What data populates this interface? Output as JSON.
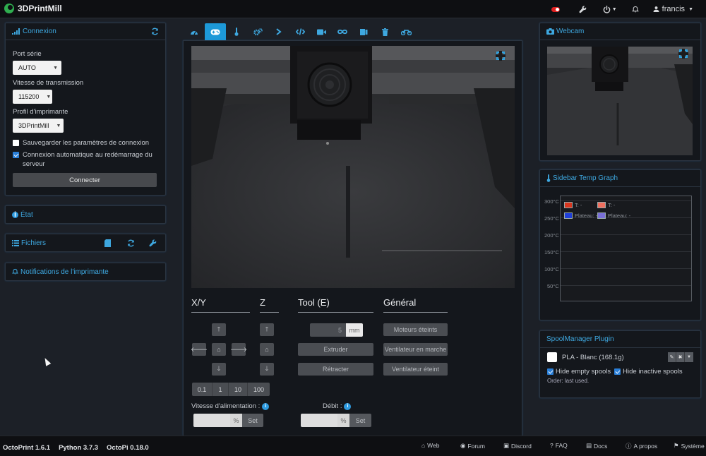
{
  "navbar": {
    "brand": "3DPrintMill",
    "user": "francis"
  },
  "connection": {
    "title": "Connexion",
    "port_label": "Port série",
    "port_value": "AUTO",
    "baud_label": "Vitesse de transmission",
    "baud_value": "115200",
    "profile_label": "Profil d'imprimante",
    "profile_value": "3DPrintMill",
    "save_label": "Sauvegarder les paramètres de connexion",
    "save_checked": false,
    "auto_label": "Connexion automatique au redémarrage du serveur",
    "auto_checked": true,
    "connect_button": "Connecter"
  },
  "state_panel": {
    "title": "État"
  },
  "files_panel": {
    "title": "Fichiers"
  },
  "notifications_panel": {
    "title": "Notifications de l'imprimante"
  },
  "tabs": [
    {
      "name": "temperature-tab",
      "icon": "gauge"
    },
    {
      "name": "control-tab",
      "icon": "gamepad",
      "active": true
    },
    {
      "name": "thermometer-tab",
      "icon": "thermometer"
    },
    {
      "name": "gcode-viewer-tab",
      "icon": "gears"
    },
    {
      "name": "terminal-tab",
      "icon": "chevron-right"
    },
    {
      "name": "code-tab",
      "icon": "code"
    },
    {
      "name": "timelapse-tab",
      "icon": "video-camera"
    },
    {
      "name": "loop-tab",
      "icon": "infinity"
    },
    {
      "name": "spool-tab",
      "icon": "spool"
    },
    {
      "name": "delete-tab",
      "icon": "trash"
    },
    {
      "name": "motorcycle-tab",
      "icon": "motorcycle"
    }
  ],
  "controls": {
    "xy_title": "X/Y",
    "z_title": "Z",
    "tool_title": "Tool (E)",
    "general_title": "Général",
    "step_sizes": [
      "0.1",
      "1",
      "10",
      "100"
    ],
    "extrude_amount": "5",
    "extrude_unit": "mm",
    "extrude_button": "Extruder",
    "retract_button": "Rétracter",
    "motors_off": "Moteurs éteints",
    "fan_on": "Ventilateur en marche",
    "fan_off": "Ventilateur éteint",
    "feed_label": "Vitesse d'alimentation :",
    "flow_label": "Débit :",
    "percent": "%",
    "set_button": "Set"
  },
  "webcam_panel": {
    "title": "Webcam"
  },
  "temp_graph": {
    "title": "Sidebar Temp Graph",
    "y_labels": [
      "300°C",
      "250°C",
      "200°C",
      "150°C",
      "100°C",
      "50°C"
    ],
    "legend": [
      {
        "label": "T: -",
        "color": "#d9361f"
      },
      {
        "label": "T: -",
        "color": "#f07060"
      },
      {
        "label": "Plateau: -",
        "color": "#1f3fd9"
      },
      {
        "label": "Plateau: -",
        "color": "#7a70d8"
      }
    ]
  },
  "spool_panel": {
    "title": "SpoolManager Plugin",
    "spool_name": "PLA - Blanc (168.1g)",
    "hide_empty": "Hide empty spools",
    "hide_inactive": "Hide inactive spools",
    "order": "Order: last used."
  },
  "footer": {
    "octoprint": "OctoPrint 1.6.1",
    "python": "Python 3.7.3",
    "octopi": "OctoPi 0.18.0",
    "links": [
      "Web",
      "Forum",
      "Discord",
      "FAQ",
      "Docs",
      "A propos",
      "Système"
    ]
  }
}
